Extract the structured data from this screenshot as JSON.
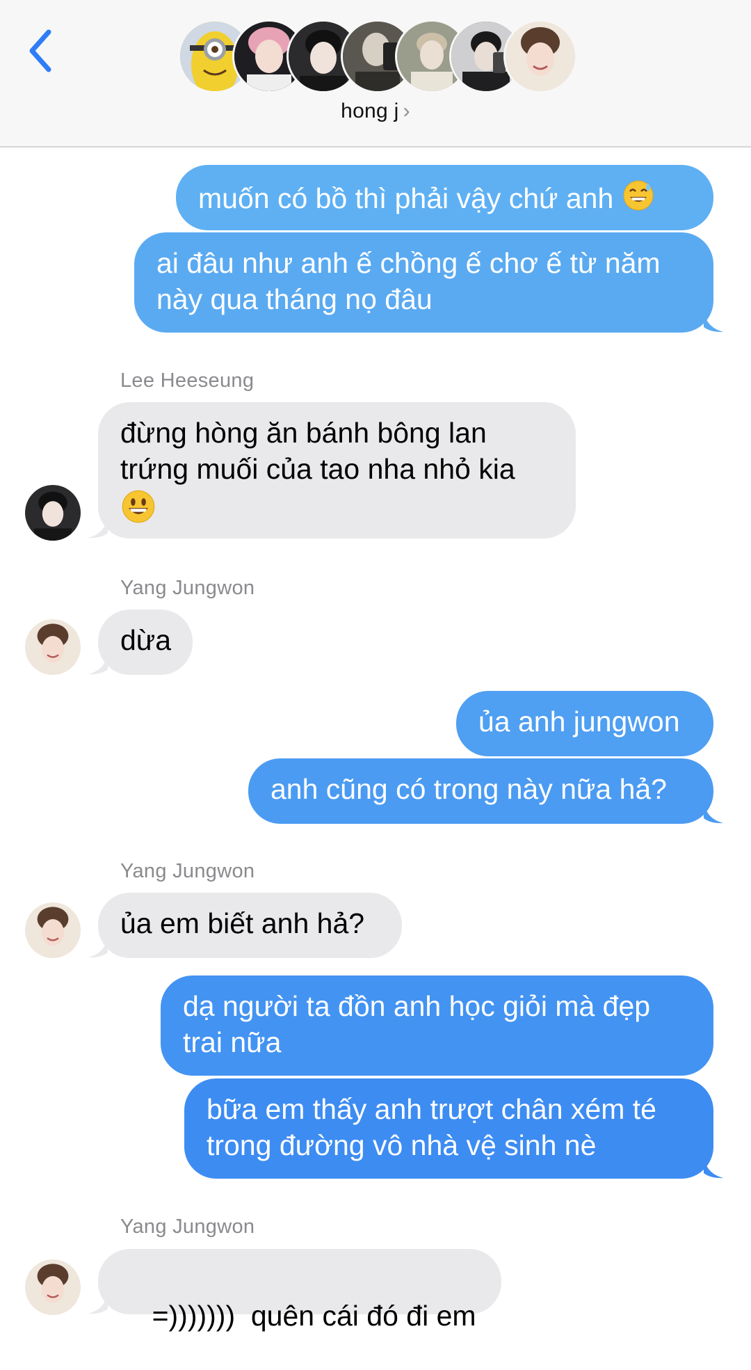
{
  "header": {
    "group_name": "hong j",
    "chevron": "›",
    "avatars": [
      {
        "name": "minion-avatar",
        "bg": "#e8c22a",
        "accent": "#4a6fa8"
      },
      {
        "name": "pink-hair-avatar",
        "bg": "#2a2a2e",
        "accent": "#e7a3b5"
      },
      {
        "name": "dark-hair-avatar",
        "bg": "#1c1c1e",
        "accent": "#f0e6e0"
      },
      {
        "name": "selfie-avatar",
        "bg": "#4b4a44",
        "accent": "#d8cfc4"
      },
      {
        "name": "light-avatar",
        "bg": "#c8c4b4",
        "accent": "#e9e4d8"
      },
      {
        "name": "mirror-avatar",
        "bg": "#3a3a3c",
        "accent": "#e2ddd7"
      },
      {
        "name": "smile-avatar",
        "bg": "#e7d7c8",
        "accent": "#5a3d2d"
      }
    ]
  },
  "colors": {
    "sent_top": "#5aabf0",
    "sent_bottom": "#3a86f2",
    "received": "#e9e9eb",
    "back_arrow": "#2f7cf6"
  },
  "messages": {
    "m1": "muốn có bồ thì phải vậy chứ anh",
    "m2_l1": "ai đâu như anh ế chồng ế chơ ế từ năm",
    "m2_l2": "này qua tháng nọ đâu",
    "s1": "Lee Heeseung",
    "m3_l1": "đừng hòng ăn bánh bông lan",
    "m3_l2": "trứng muối của tao nha nhỏ kia",
    "s2": "Yang Jungwon",
    "m4": "dừa",
    "m5": "ủa anh jungwon",
    "m6": "anh cũng có trong này nữa hả?",
    "s3": "Yang Jungwon",
    "m7": "ủa em biết anh hả?",
    "m8_l1": "dạ người ta đồn anh học giỏi mà đẹp",
    "m8_l2": "trai nữa",
    "m9_l1": "bữa em thấy anh trượt chân xém té",
    "m9_l2": "trong đường vô nhà vệ sinh nè",
    "s4": "Yang Jungwon",
    "m10": "=)))))))  quên cái đó đi em"
  },
  "icons": {
    "sweat_emoji": "grinning-sweat-emoji",
    "smile_emoji": "smiling-face-emoji"
  }
}
